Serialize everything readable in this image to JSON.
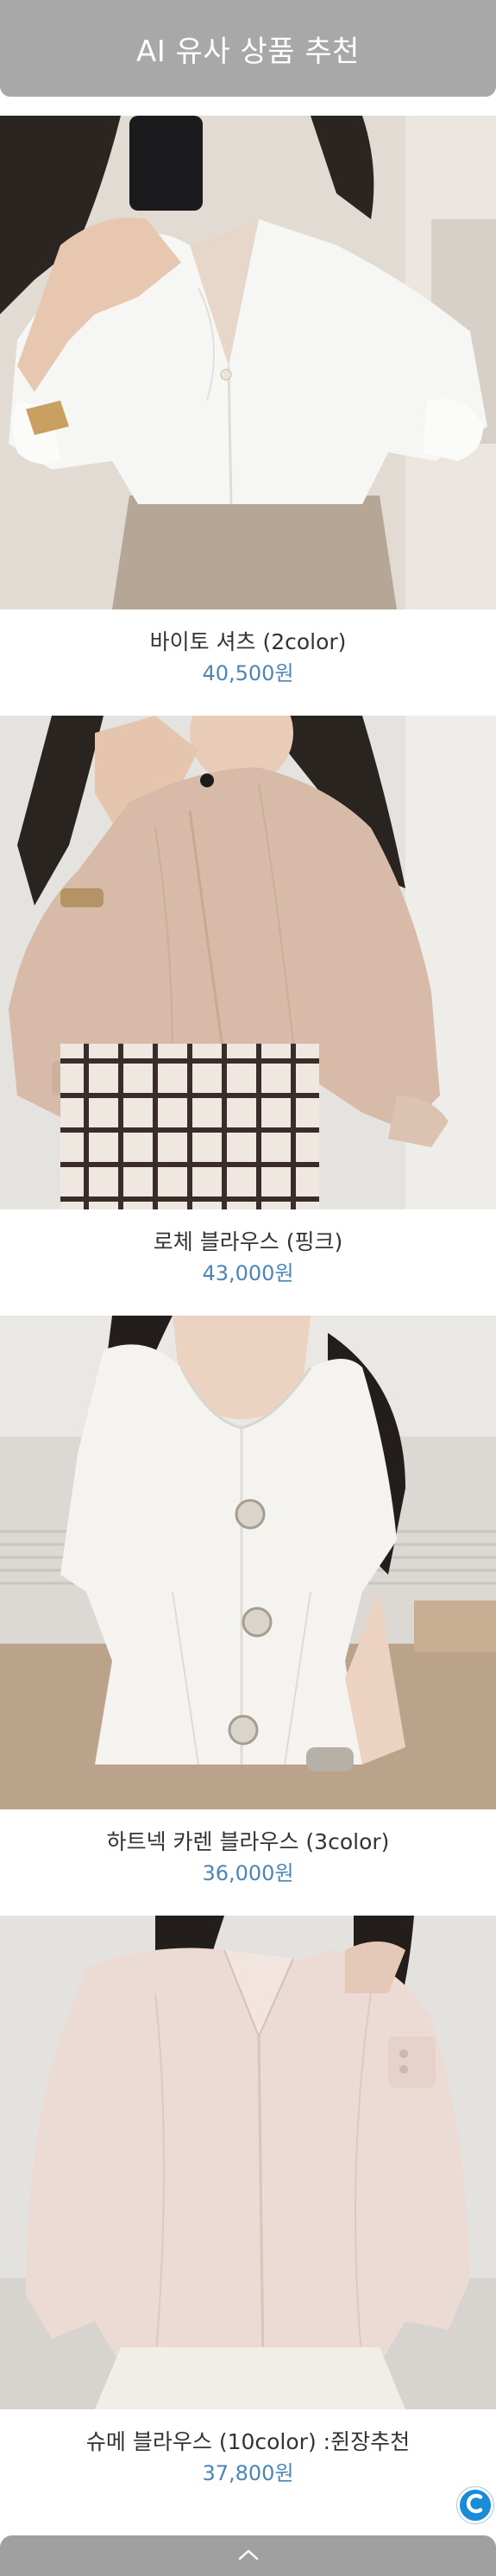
{
  "header": {
    "title": "AI 유사 상품 추천"
  },
  "products": [
    {
      "name": "바이토 셔츠 (2color)",
      "price": "40,500원"
    },
    {
      "name": "로체 블라우스 (핑크)",
      "price": "43,000원"
    },
    {
      "name": "하트넥 카렌 블라우스 (3color)",
      "price": "36,000원"
    },
    {
      "name": "슈메 블라우스 (10color) :쥔장추천",
      "price": "37,800원"
    }
  ],
  "floating": {
    "cs_icon": "c-chat-icon",
    "scroll_top_icon": "chevron-up-icon"
  },
  "colors": {
    "header_bg": "#a8a8a8",
    "price": "#4a86b8",
    "cs_button": "#1a8bd8"
  }
}
